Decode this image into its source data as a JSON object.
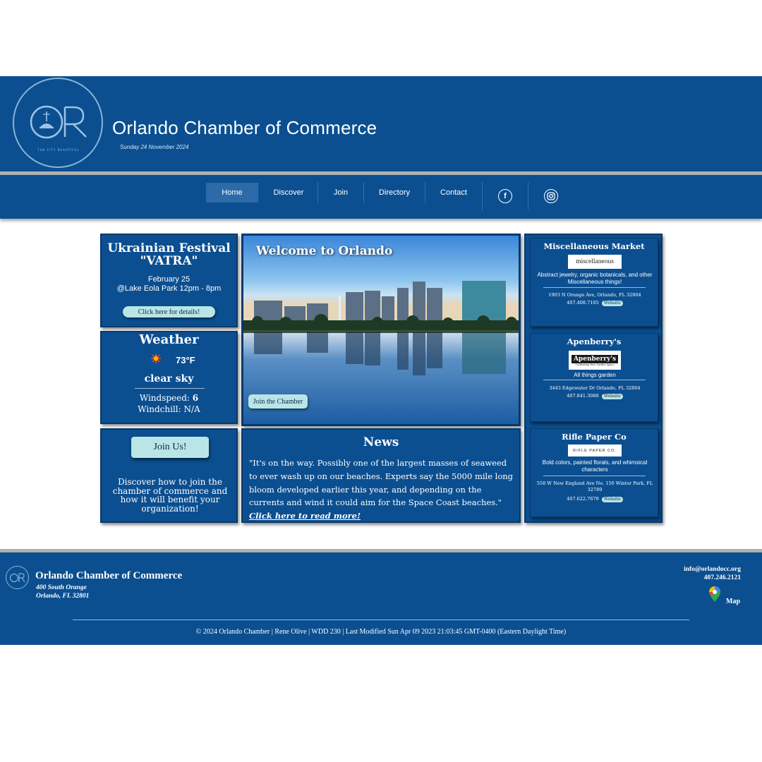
{
  "header": {
    "logo_tagline": "THE CITY BEAUTIFUL",
    "title": "Orlando Chamber of Commerce",
    "date": "Sunday 24 November 2024"
  },
  "nav": {
    "items": [
      {
        "label": "Home",
        "active": true
      },
      {
        "label": "Discover"
      },
      {
        "label": "Join"
      },
      {
        "label": "Directory"
      },
      {
        "label": "Contact"
      }
    ],
    "social": [
      {
        "icon": "facebook-icon"
      },
      {
        "icon": "instagram-icon"
      }
    ]
  },
  "event": {
    "title": "Ukrainian Festival \"VATRA\"",
    "date": "February 25",
    "location": "@Lake Eola Park 12pm - 8pm",
    "button": "Click here for details!"
  },
  "weather": {
    "title": "Weather",
    "icon": "sun-icon",
    "temp": "73°F",
    "description": "clear sky",
    "windspeed_label": "Windspeed:",
    "windspeed_value": "6",
    "windchill": "Windchill: N/A"
  },
  "hero": {
    "title": "Welcome to Orlando",
    "button": "Join the Chamber"
  },
  "join": {
    "button": "Join Us!",
    "text": "Discover how to join the chamber of commerce and how it will benefit your organization!"
  },
  "news": {
    "title": "News",
    "body": "\"It's on the way. Possibly one of the largest masses of seaweed to ever wash up on our beaches. Experts say the 5000 mile long bloom developed earlier this year, and depending on the currents and wind it could aim for the Space Coast beaches.\"",
    "link": "Click here to read more!"
  },
  "businesses": [
    {
      "name": "Miscellaneous Market",
      "logo_text": "miscellaneous",
      "description": "Abstract jewelry, organic botanicals, and other Miscellaneous things!",
      "address": "1903 N Orange Ave, Orlando, FL 32804",
      "phone": "407.408.7105",
      "website": "Website"
    },
    {
      "name": "Apenberry's",
      "logo_text": "Apenberry's",
      "logo_sub": "Cultivating Your Garden Space",
      "description": "All things garden",
      "address": "3443 Edgewater Dr Orlando, FL 32804",
      "phone": "407.841.3088",
      "website": "Website"
    },
    {
      "name": "Rifle Paper Co",
      "logo_text": "RIFLE PAPER CO.",
      "description": "Bold colors, painted florals, and whimsical characters",
      "address": "558 W New England Ave No. 150 Winter Park, FL 32789",
      "phone": "407.622.7679",
      "website": "Website"
    }
  ],
  "footer": {
    "title": "Orlando Chamber of Commerce",
    "address_line1": "400 South Orange",
    "address_line2": "Orlando, FL 32801",
    "email": "info@orlandocc.org",
    "phone": "407.246.2121",
    "map_label": "Map",
    "copyright": "© 2024 Orlando Chamber | Rene Olive | WDD 230 | Last Modified Sun Apr 09 2023 21:03:45 GMT-0400 (Eastern Daylight Time)"
  },
  "colors": {
    "brand_blue": "#0b4f91",
    "accent_teal": "#b9e5e6"
  }
}
